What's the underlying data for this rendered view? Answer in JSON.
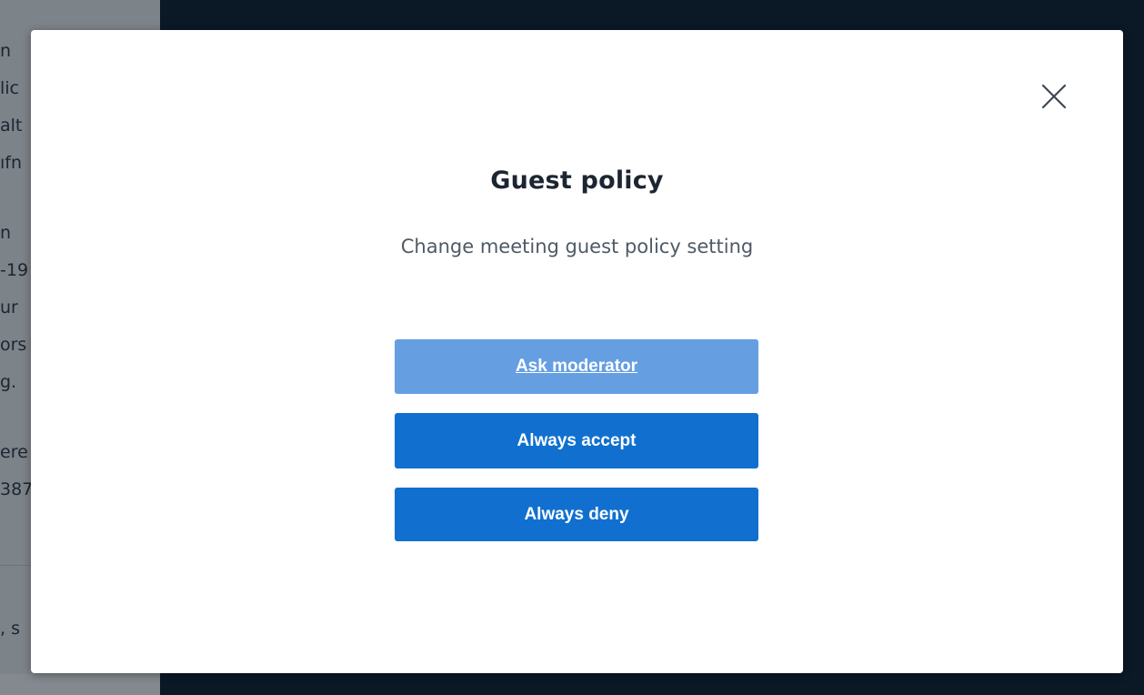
{
  "background": {
    "chat_lines": [
      "n",
      "lic",
      "alt",
      "ıfn",
      "",
      "n",
      "-19",
      "ur",
      "ors",
      "g.",
      "",
      "ere",
      "387"
    ],
    "chat_footer": ", s"
  },
  "modal": {
    "title": "Guest policy",
    "description": "Change meeting guest policy setting",
    "close_icon": "close-icon",
    "options": [
      {
        "label": "Ask moderator",
        "selected": true
      },
      {
        "label": "Always accept",
        "selected": false
      },
      {
        "label": "Always deny",
        "selected": false
      }
    ]
  },
  "colors": {
    "backdrop": "#0b1826",
    "modal_bg": "#ffffff",
    "button_primary": "#1170cf",
    "button_selected": "#659fe2",
    "title_text": "#1c2531",
    "desc_text": "#4e5a66"
  }
}
